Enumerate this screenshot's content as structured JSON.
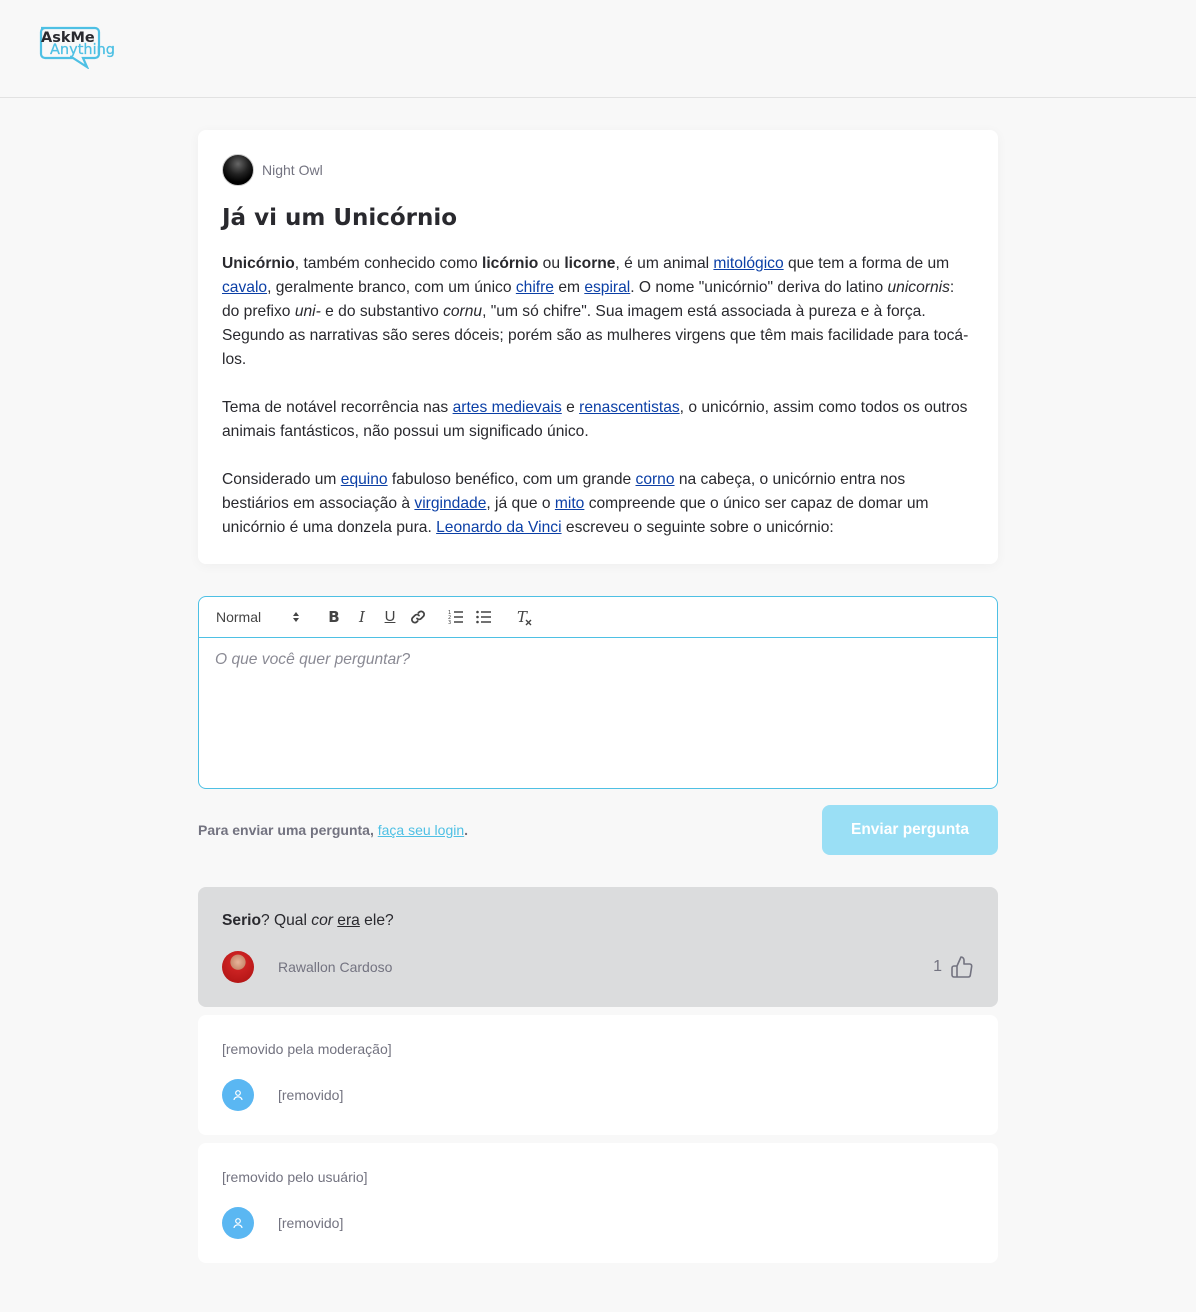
{
  "logo": {
    "line1": "AskMe",
    "line2": "Anything"
  },
  "room": {
    "author": "Night Owl",
    "title": "Já vi um Unicórnio"
  },
  "content": {
    "p1": [
      {
        "t": "b",
        "v": "Unicórnio"
      },
      {
        "t": "s",
        "v": ", também conhecido como "
      },
      {
        "t": "b",
        "v": "licórnio"
      },
      {
        "t": "s",
        "v": " ou "
      },
      {
        "t": "b",
        "v": "licorne"
      },
      {
        "t": "s",
        "v": ", é um animal "
      },
      {
        "t": "a",
        "v": "mitológico"
      },
      {
        "t": "s",
        "v": " que tem a forma de um "
      },
      {
        "t": "a",
        "v": "cavalo"
      },
      {
        "t": "s",
        "v": ", geralmente branco, com um único "
      },
      {
        "t": "a",
        "v": "chifre"
      },
      {
        "t": "s",
        "v": " em "
      },
      {
        "t": "a",
        "v": "espiral"
      },
      {
        "t": "s",
        "v": ". O nome \"unicórnio\" deriva do latino "
      },
      {
        "t": "i",
        "v": "unicornis"
      },
      {
        "t": "s",
        "v": ": do prefixo "
      },
      {
        "t": "i",
        "v": "uni-"
      },
      {
        "t": "s",
        "v": " e do substantivo "
      },
      {
        "t": "i",
        "v": "cornu"
      },
      {
        "t": "s",
        "v": ", \"um só chifre\". Sua imagem está associada à pureza e à força. Segundo as narrativas são seres dóceis; porém são as mulheres virgens que têm mais facilidade para tocá-los."
      }
    ],
    "p2": [
      {
        "t": "s",
        "v": "Tema de notável recorrência nas "
      },
      {
        "t": "a",
        "v": "artes medievais"
      },
      {
        "t": "s",
        "v": " e "
      },
      {
        "t": "a",
        "v": "renascentistas"
      },
      {
        "t": "s",
        "v": ", o unicórnio, assim como todos os outros animais fantásticos, não possui um significado único."
      }
    ],
    "p3": [
      {
        "t": "s",
        "v": "Considerado um "
      },
      {
        "t": "a",
        "v": "equino"
      },
      {
        "t": "s",
        "v": " fabuloso benéfico, com um grande "
      },
      {
        "t": "a",
        "v": "corno"
      },
      {
        "t": "s",
        "v": " na cabeça, o unicórnio entra nos bestiários em associação à "
      },
      {
        "t": "a",
        "v": "virgindade"
      },
      {
        "t": "s",
        "v": ", já que o "
      },
      {
        "t": "a",
        "v": "mito"
      },
      {
        "t": "s",
        "v": " compreende que o único ser capaz de domar um unicórnio é uma donzela pura. "
      },
      {
        "t": "a",
        "v": "Leonardo da Vinci"
      },
      {
        "t": "s",
        "v": " escreveu o seguinte sobre o unicórnio:"
      }
    ]
  },
  "editor": {
    "format_select": "Normal",
    "bold": "B",
    "italic": "I",
    "underline": "U",
    "clean": "T",
    "placeholder": "O que você quer perguntar?"
  },
  "submit": {
    "note": "Para enviar uma pergunta, ",
    "login_link": "faça seu login",
    "note_end": ".",
    "button": "Enviar pergunta"
  },
  "questions": [
    {
      "rich": [
        {
          "t": "b",
          "v": "Serio"
        },
        {
          "t": "s",
          "v": "? Qual "
        },
        {
          "t": "i",
          "v": "cor"
        },
        {
          "t": "s",
          "v": " "
        },
        {
          "t": "u",
          "v": "era"
        },
        {
          "t": "s",
          "v": " ele?"
        }
      ],
      "author": "Rawallon Cardoso",
      "likes": "1"
    },
    {
      "text": "[removido pela moderação]",
      "author": "[removido]"
    },
    {
      "text": "[removido pelo usuário]",
      "author": "[removido]"
    }
  ],
  "colors": {
    "accent": "#4ec0e4",
    "button_disabled": "#9adff5",
    "link": "#0b3fa6",
    "highlight_bg": "#dbdcdd"
  }
}
